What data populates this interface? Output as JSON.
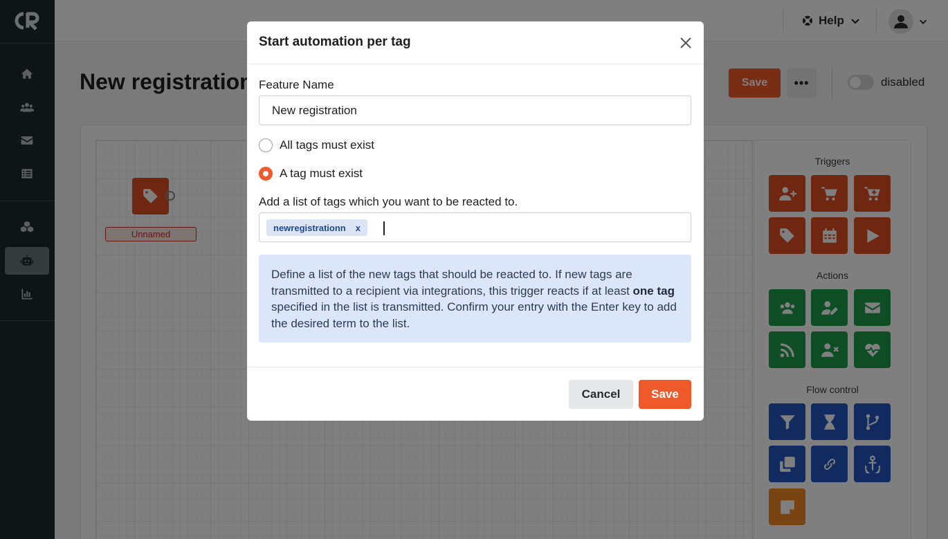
{
  "app": {
    "logo_text": "CR"
  },
  "sidebar": {
    "items": [
      {
        "icon": "home-icon",
        "active": false
      },
      {
        "icon": "users-icon",
        "active": false
      },
      {
        "icon": "envelope-icon",
        "active": false
      },
      {
        "icon": "list-icon",
        "active": false
      },
      {
        "icon": "cubes-icon",
        "active": false
      },
      {
        "icon": "robot-icon",
        "active": true
      },
      {
        "icon": "chart-icon",
        "active": false
      }
    ]
  },
  "topbar": {
    "help_label": "Help",
    "help_icon": "life-ring-icon",
    "avatar_icon": "user-icon"
  },
  "page": {
    "title": "New registration",
    "save_label": "Save",
    "more_label": "•••",
    "status_label": "disabled",
    "status_enabled": false
  },
  "canvas": {
    "node_icon": "tag-icon",
    "node_label": "Unnamed"
  },
  "palette": {
    "triggers_title": "Triggers",
    "actions_title": "Actions",
    "flow_title": "Flow control"
  },
  "modal": {
    "title": "Start automation per tag",
    "feature_name_label": "Feature Name",
    "feature_name_value": "New registration",
    "radio_all_label": "All tags must exist",
    "radio_one_label": "A tag must exist",
    "selected_option": "one",
    "tags_label": "Add a list of tags which you want to be reacted to.",
    "tags": [
      "newregistrationn"
    ],
    "tag_remove_label": "x",
    "info_part1": "Define a list of the new tags that should be reacted to. If new tags are transmitted to a recipient via integrations, this trigger reacts if at least ",
    "info_bold": "one tag",
    "info_part2": " specified in the list is transmitted. Confirm your entry with the Enter key to add the desired term to the list.",
    "cancel_label": "Cancel",
    "save_label": "Save"
  },
  "colors": {
    "accent": "#f05a2b",
    "trigger": "#e04e22",
    "action": "#1f9d48",
    "flow": "#2357c2",
    "note": "#f08a24",
    "sidebar_bg": "#1f2a2e"
  }
}
